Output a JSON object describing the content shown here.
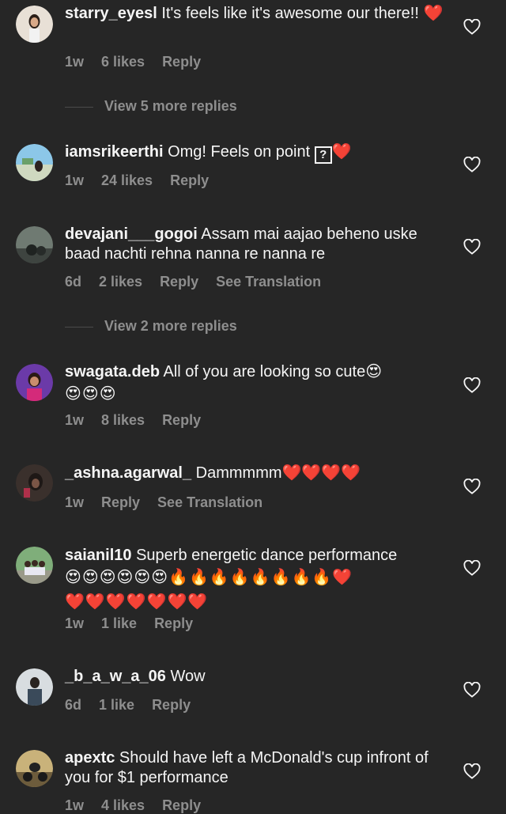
{
  "comments": [
    {
      "username": "starry_eyesl",
      "text": " It's feels like it's awesome our there!! ❤️",
      "emojis": "",
      "time": "1w",
      "likes": "6 likes",
      "reply": "Reply",
      "translation": ""
    },
    {
      "username": "iamsrikeerthi",
      "text": " Omg! Feels on point ",
      "text_tail": "❤️",
      "emojis": "",
      "time": "1w",
      "likes": "24 likes",
      "reply": "Reply",
      "translation": ""
    },
    {
      "username": "devajani___gogoi",
      "text": " Assam mai aajao beheno uske baad nachti rehna nanna re nanna re",
      "emojis": "",
      "time": "6d",
      "likes": "2 likes",
      "reply": "Reply",
      "translation": "See Translation"
    },
    {
      "username": "swagata.deb",
      "text": " All of you are looking so cute😍",
      "emojis": "😍😍😍",
      "time": "1w",
      "likes": "8 likes",
      "reply": "Reply",
      "translation": ""
    },
    {
      "username": "_ashna.agarwal_",
      "text": " Dammmmm❤️❤️❤️❤️",
      "emojis": "",
      "time": "1w",
      "likes": "",
      "reply": "Reply",
      "translation": "See Translation"
    },
    {
      "username": "saianil10",
      "text": " Superb energetic dance performance",
      "emojis": "😍😍😍😍😍😍🔥🔥🔥🔥🔥🔥🔥🔥❤️",
      "emojis2": "❤️❤️❤️❤️❤️❤️❤️",
      "time": "1w",
      "likes": "1 like",
      "reply": "Reply",
      "translation": ""
    },
    {
      "username": "_b_a_w_a_06",
      "text": " Wow",
      "emojis": "",
      "time": "6d",
      "likes": "1 like",
      "reply": "Reply",
      "translation": ""
    },
    {
      "username": "apextc",
      "text": " Should have left a McDonald's cup infront of you for $1 performance",
      "emojis": "",
      "time": "1w",
      "likes": "4 likes",
      "reply": "Reply",
      "translation": ""
    }
  ],
  "more_replies": [
    "View 5 more replies",
    "View 2 more replies"
  ],
  "icons": {
    "heart": "heart-outline-icon",
    "unknown_glyph": "?"
  },
  "colors": {
    "background": "#262626",
    "text": "#f5f5f5",
    "secondary": "#8e8e8e"
  }
}
